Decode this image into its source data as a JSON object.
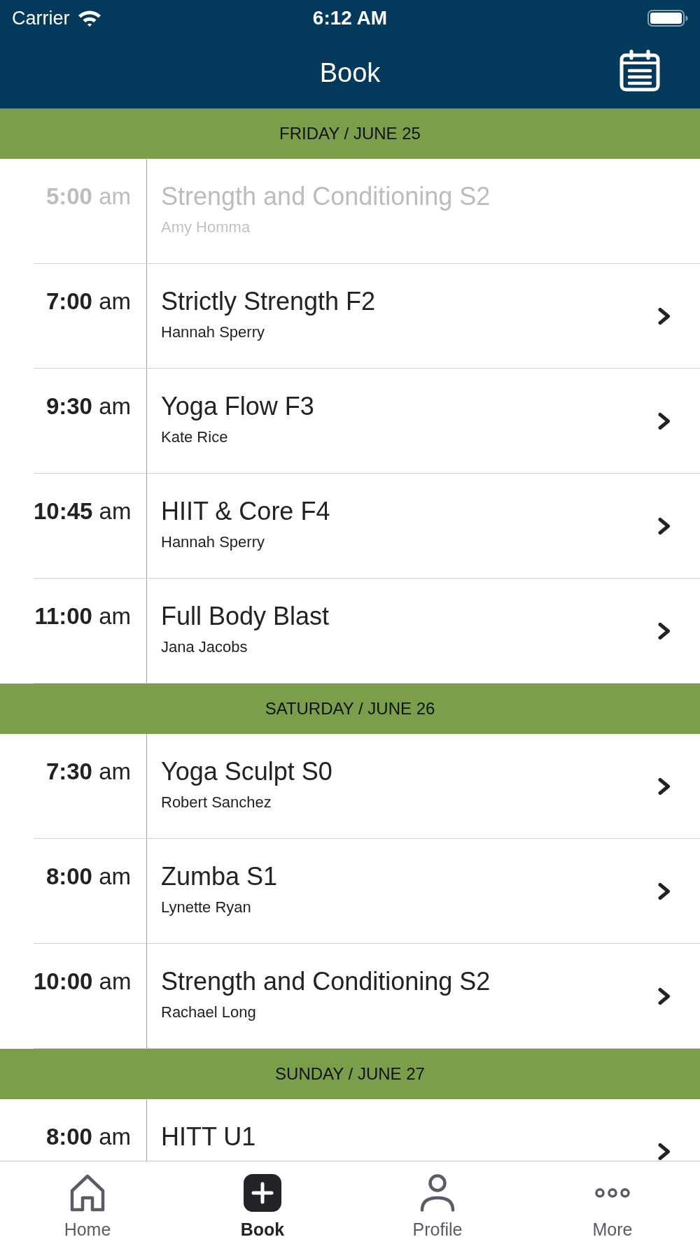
{
  "status_bar": {
    "carrier": "Carrier",
    "time": "6:12 AM"
  },
  "header": {
    "title": "Book"
  },
  "sections": [
    {
      "date": "FRIDAY / JUNE 25",
      "sessions": [
        {
          "time": "**5:00** am",
          "title": "Strength and Conditioning S2",
          "instructor": "Amy Homma",
          "disabled": true
        },
        {
          "time": "**7:00** am",
          "title": "Strictly Strength F2",
          "instructor": "Hannah Sperry",
          "disabled": false
        },
        {
          "time": "**9:30** am",
          "title": "Yoga Flow F3",
          "instructor": "Kate Rice",
          "disabled": false
        },
        {
          "time": "**10:45** am",
          "title": "HIIT & Core F4",
          "instructor": "Hannah Sperry",
          "disabled": false
        },
        {
          "time": "**11:00** am",
          "title": "Full Body Blast",
          "instructor": "Jana Jacobs",
          "disabled": false
        }
      ]
    },
    {
      "date": "SATURDAY / JUNE 26",
      "sessions": [
        {
          "time": "**7:30** am",
          "title": "Yoga Sculpt S0",
          "instructor": "Robert Sanchez",
          "disabled": false
        },
        {
          "time": "**8:00** am",
          "title": "Zumba S1",
          "instructor": "Lynette Ryan",
          "disabled": false
        },
        {
          "time": "**10:00** am",
          "title": "Strength and Conditioning S2",
          "instructor": "Rachael Long",
          "disabled": false
        }
      ]
    },
    {
      "date": "SUNDAY / JUNE 27",
      "sessions": [
        {
          "time": "**8:00** am",
          "title": "HITT U1",
          "disabled": false
        }
      ]
    }
  ],
  "tabs": [
    {
      "label": "Home",
      "selected": false
    },
    {
      "label": "Book",
      "selected": true
    },
    {
      "label": "Profile",
      "selected": false
    },
    {
      "label": "More",
      "selected": false
    }
  ]
}
